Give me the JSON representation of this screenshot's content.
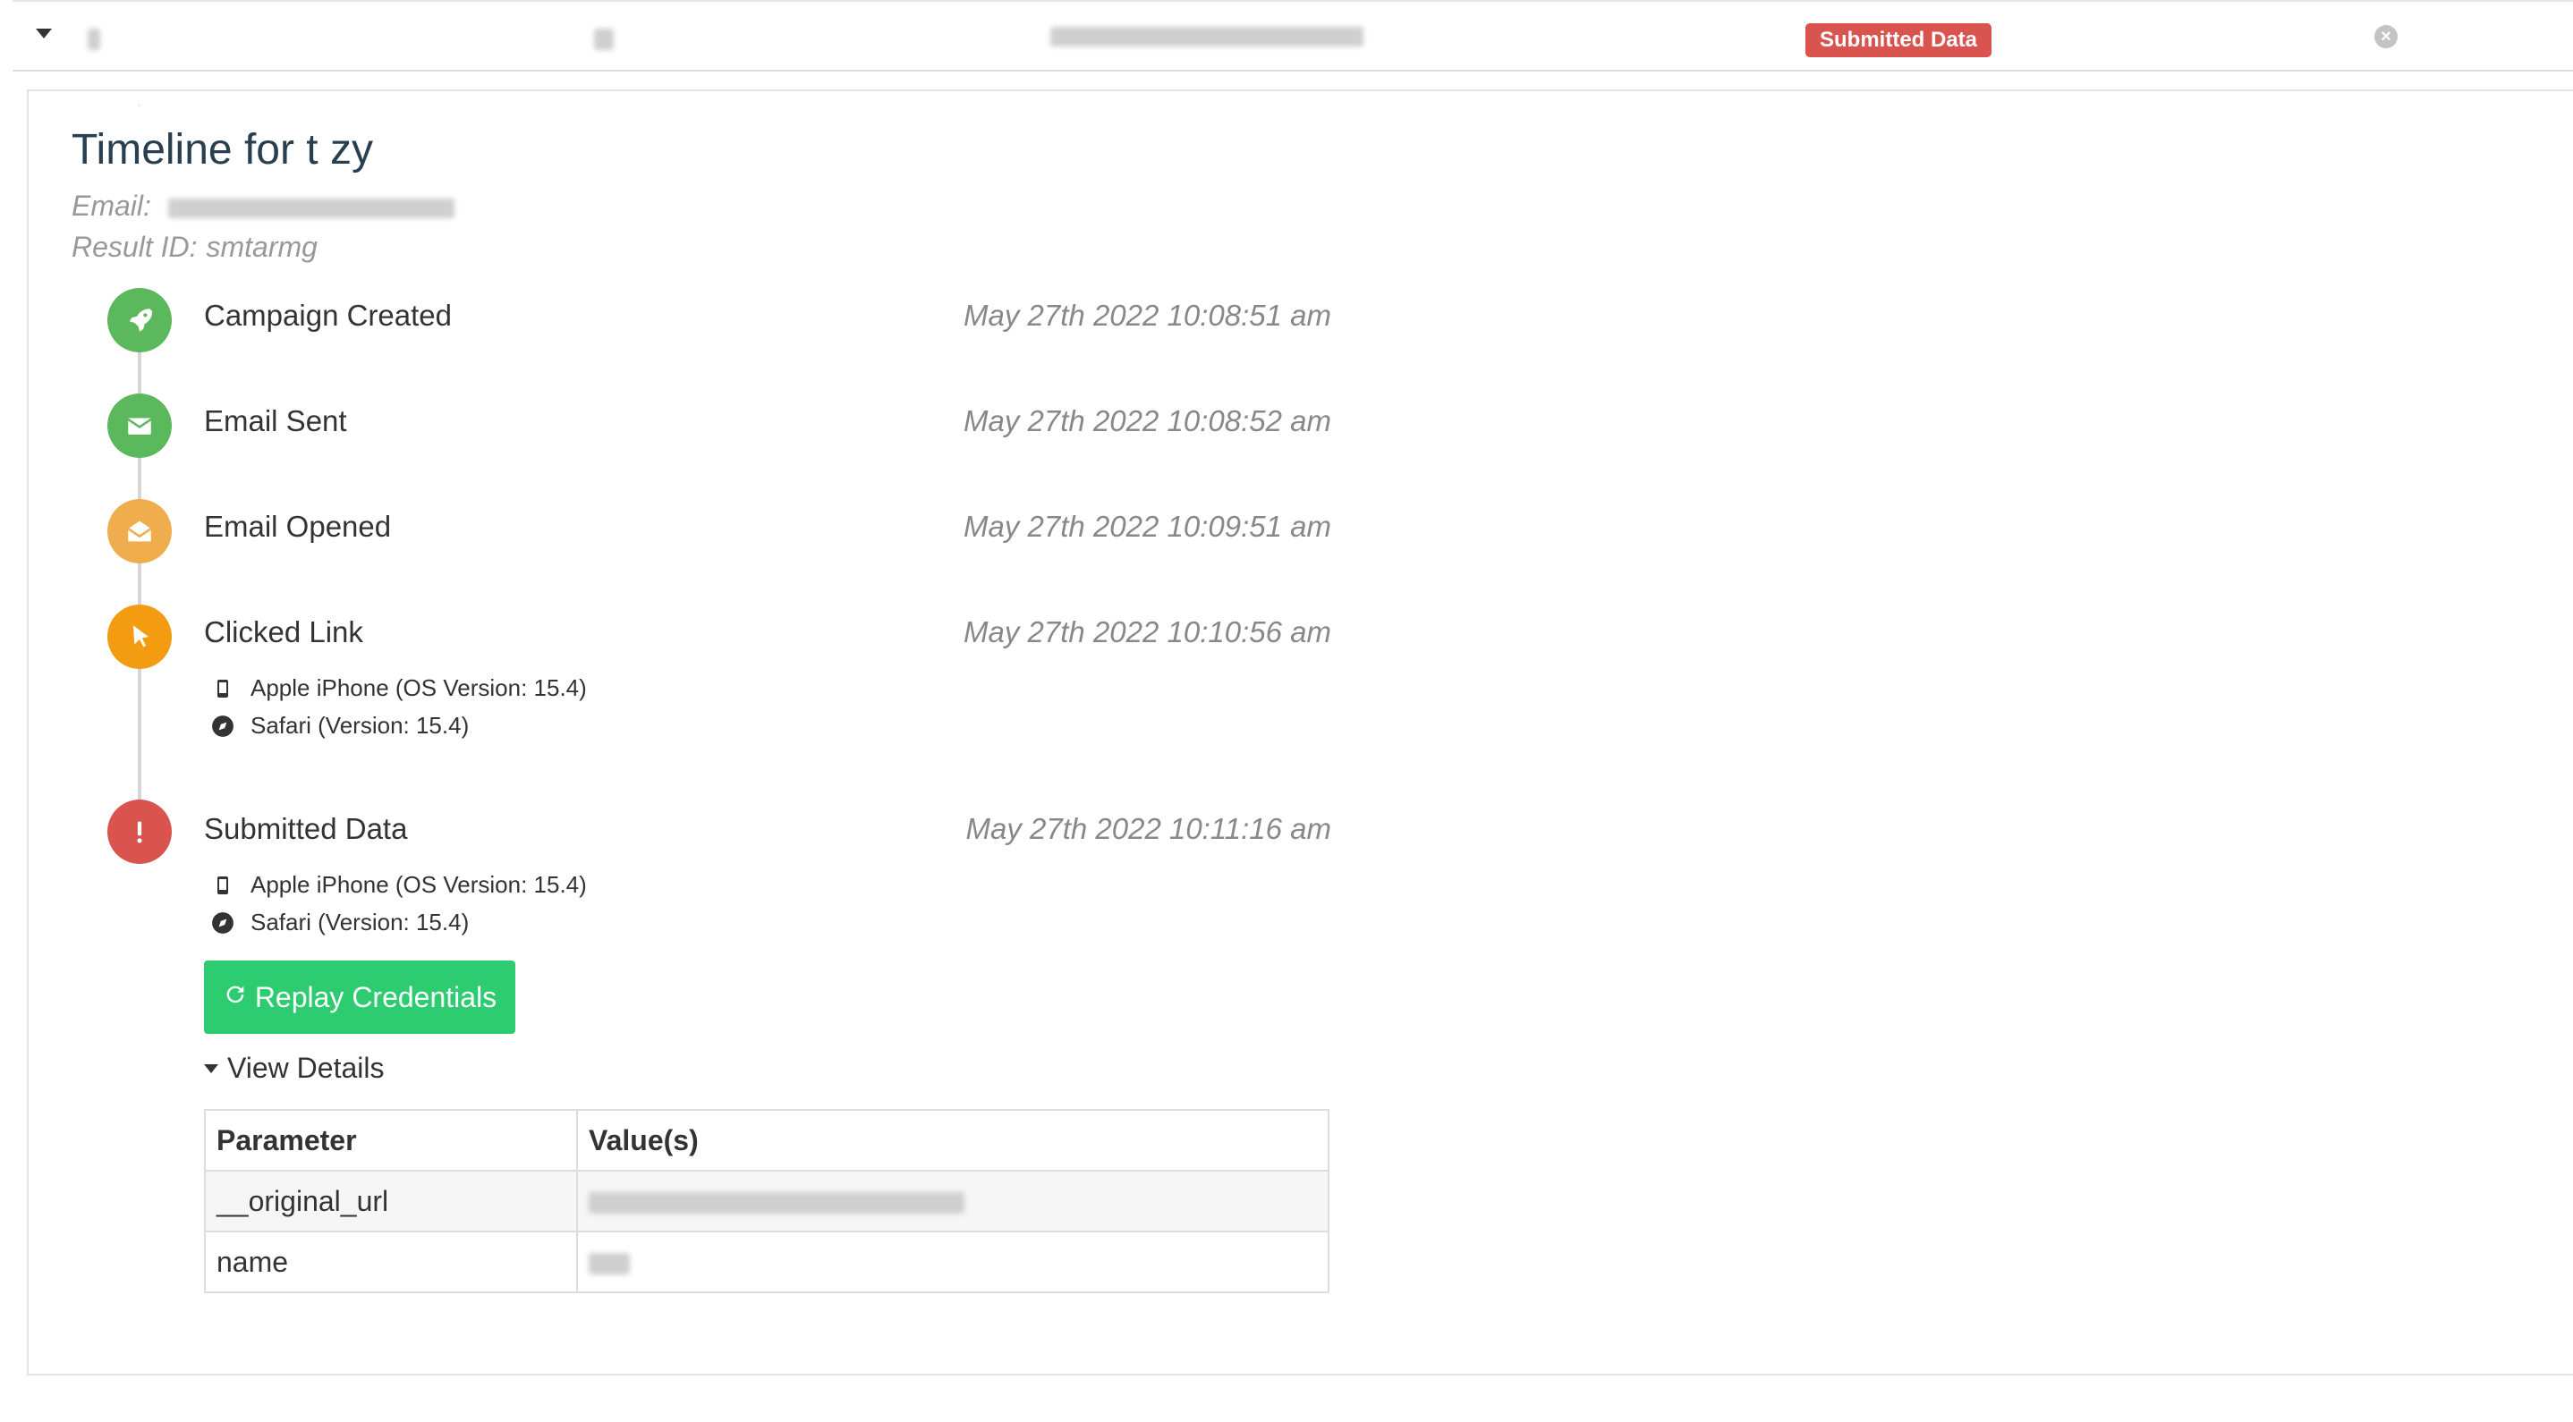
{
  "top_row": {
    "badge": "Submitted Data"
  },
  "timeline": {
    "title": "Timeline for t zy",
    "email_label": "Email:",
    "result_label": "Result ID:",
    "result_id": "smtarmg"
  },
  "events": [
    {
      "title": "Campaign Created",
      "date": "May 27th 2022 10:08:51 am",
      "icon": "rocket-icon",
      "color": "#5cb85c"
    },
    {
      "title": "Email Sent",
      "date": "May 27th 2022 10:08:52 am",
      "icon": "envelope-icon",
      "color": "#5cb85c"
    },
    {
      "title": "Email Opened",
      "date": "May 27th 2022 10:09:51 am",
      "icon": "envelope-open-icon",
      "color": "#f0ad4e"
    },
    {
      "title": "Clicked Link",
      "date": "May 27th 2022 10:10:56 am",
      "icon": "pointer-icon",
      "color": "#f39c12",
      "device": "Apple iPhone (OS Version: 15.4)",
      "browser": "Safari (Version: 15.4)"
    },
    {
      "title": "Submitted Data",
      "date": "May 27th 2022 10:11:16 am",
      "icon": "exclamation-icon",
      "color": "#d9534f",
      "device": "Apple iPhone (OS Version: 15.4)",
      "browser": "Safari (Version: 15.4)"
    }
  ],
  "actions": {
    "replay_label": "Replay Credentials",
    "view_details_label": "View Details"
  },
  "details_table": {
    "headers": [
      "Parameter",
      "Value(s)"
    ],
    "rows": [
      {
        "param": "__original_url"
      },
      {
        "param": "name"
      }
    ]
  }
}
